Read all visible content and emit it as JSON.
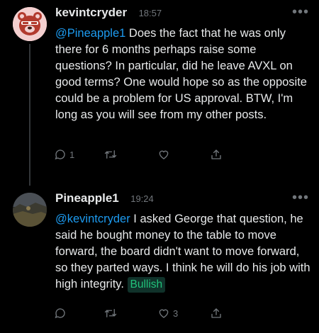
{
  "posts": [
    {
      "username": "kevintcryder",
      "time": "18:57",
      "mention": "@Pineapple1",
      "text": " Does the fact that he was only there for 6 months perhaps raise some questions? In particular, did he leave AVXL on good terms? One would hope so as the opposite could be a problem for US approval. BTW, I'm long as you will see from my other posts.",
      "reply_count": "1",
      "like_count": ""
    },
    {
      "username": "Pineapple1",
      "time": "19:24",
      "mention": "@kevintcryder",
      "text": " I asked George that question, he said he bought money to the table to move forward, the board didn't want to move forward, so they parted ways. I think he will do his job with high integrity. ",
      "badge": "Bullish",
      "reply_count": "",
      "like_count": "3"
    }
  ],
  "more_glyph": "•••",
  "colors": {
    "background": "#000000",
    "text": "#e7e9ea",
    "muted": "#71767b",
    "mention": "#1d9bf0",
    "bullish_text": "#21c27b",
    "bullish_bg": "#10322a"
  },
  "icons": {
    "reply": "speech-bubble-icon",
    "repost": "repost-arrows-icon",
    "like": "heart-icon",
    "share": "share-upload-icon",
    "more": "more-dots-icon"
  }
}
